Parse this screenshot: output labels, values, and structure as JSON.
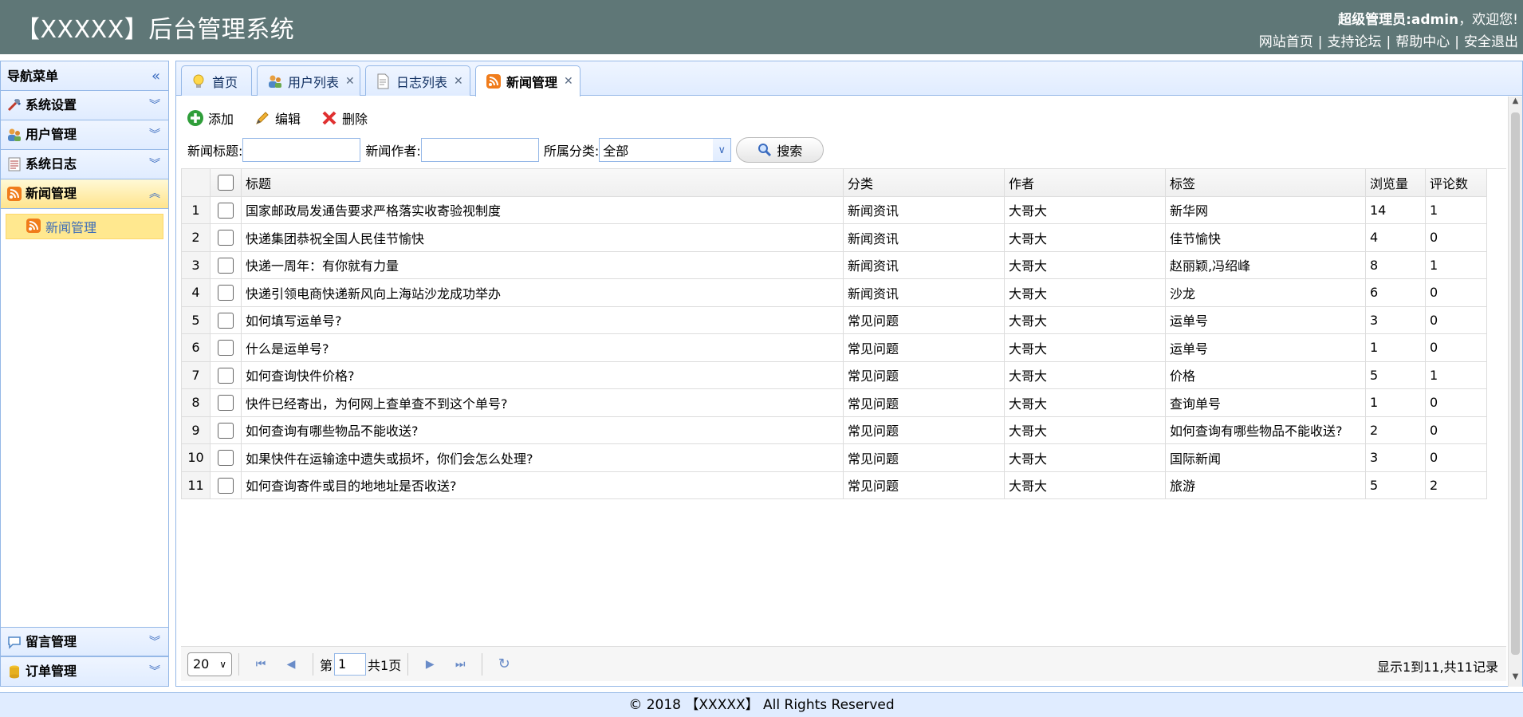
{
  "header": {
    "title": "【XXXXX】后台管理系统",
    "role": "超级管理员:admin",
    "welcome": "，欢迎您!",
    "links": [
      "网站首页",
      "支持论坛",
      "帮助中心",
      "安全退出"
    ]
  },
  "sidebar": {
    "title": "导航菜单",
    "groups": [
      {
        "label": "系统设置",
        "icon": "tools-icon"
      },
      {
        "label": "用户管理",
        "icon": "users-icon"
      },
      {
        "label": "系统日志",
        "icon": "log-icon"
      },
      {
        "label": "新闻管理",
        "icon": "rss-icon",
        "active": true
      }
    ],
    "active_sub": "新闻管理",
    "bottom_groups": [
      {
        "label": "留言管理",
        "icon": "comment-icon"
      },
      {
        "label": "订单管理",
        "icon": "database-icon"
      }
    ]
  },
  "tabs": [
    {
      "label": "首页",
      "closable": false
    },
    {
      "label": "用户列表",
      "closable": true
    },
    {
      "label": "日志列表",
      "closable": true
    },
    {
      "label": "新闻管理",
      "closable": true,
      "active": true
    }
  ],
  "toolbar": {
    "add": "添加",
    "edit": "编辑",
    "delete": "删除"
  },
  "search": {
    "title_label": "新闻标题:",
    "author_label": "新闻作者:",
    "category_label": "所属分类:",
    "category_value": "全部",
    "button": "搜索"
  },
  "table": {
    "columns": [
      "标题",
      "分类",
      "作者",
      "标签",
      "浏览量",
      "评论数"
    ],
    "rows": [
      [
        "国家邮政局发通告要求严格落实收寄验视制度",
        "新闻资讯",
        "大哥大",
        "新华网",
        "14",
        "1"
      ],
      [
        "快递集团恭祝全国人民佳节愉快",
        "新闻资讯",
        "大哥大",
        "佳节愉快",
        "4",
        "0"
      ],
      [
        "快递一周年：有你就有力量",
        "新闻资讯",
        "大哥大",
        "赵丽颖,冯绍峰",
        "8",
        "1"
      ],
      [
        "快递引领电商快递新风向上海站沙龙成功举办",
        "新闻资讯",
        "大哥大",
        "沙龙",
        "6",
        "0"
      ],
      [
        "如何填写运单号?",
        "常见问题",
        "大哥大",
        "运单号",
        "3",
        "0"
      ],
      [
        "什么是运单号?",
        "常见问题",
        "大哥大",
        "运单号",
        "1",
        "0"
      ],
      [
        "如何查询快件价格?",
        "常见问题",
        "大哥大",
        "价格",
        "5",
        "1"
      ],
      [
        "快件已经寄出，为何网上查单查不到这个单号?",
        "常见问题",
        "大哥大",
        "查询单号",
        "1",
        "0"
      ],
      [
        "如何查询有哪些物品不能收送?",
        "常见问题",
        "大哥大",
        "如何查询有哪些物品不能收送?",
        "2",
        "0"
      ],
      [
        "如果快件在运输途中遗失或损坏，你们会怎么处理?",
        "常见问题",
        "大哥大",
        "国际新闻",
        "3",
        "0"
      ],
      [
        "如何查询寄件或目的地地址是否收送?",
        "常见问题",
        "大哥大",
        "旅游",
        "5",
        "2"
      ]
    ]
  },
  "pager": {
    "page_size": "20",
    "page_prefix": "第",
    "page_value": "1",
    "page_total": "共1页",
    "info": "显示1到11,共11记录"
  },
  "footer": "© 2018 【XXXXX】 All Rights Reserved"
}
